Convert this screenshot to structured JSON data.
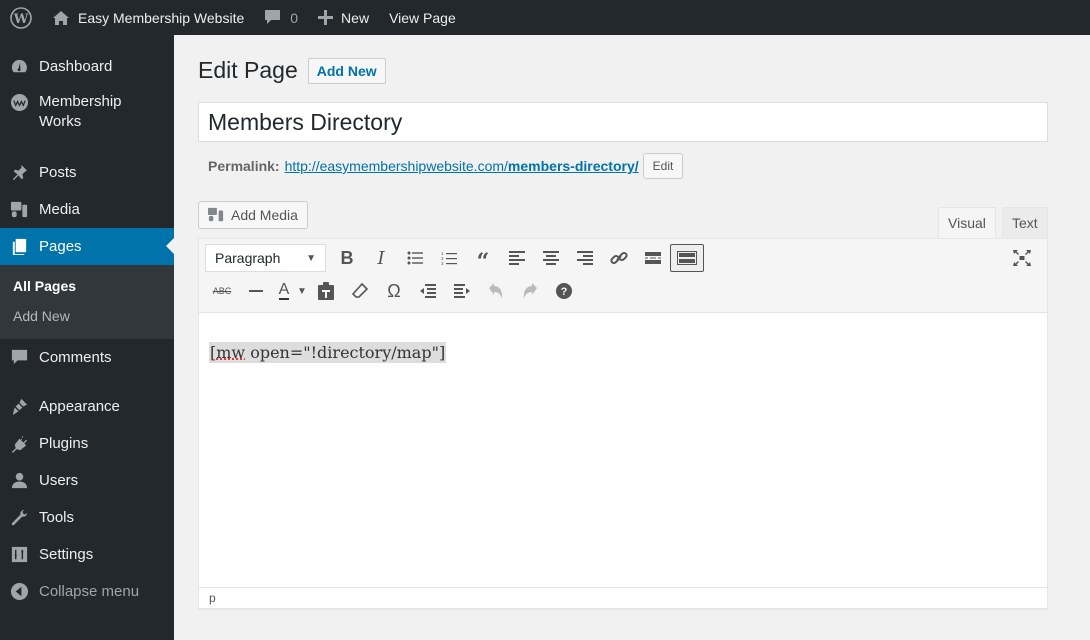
{
  "adminbar": {
    "site_name": "Easy Membership Website",
    "comments_count": "0",
    "new_label": "New",
    "view_page_label": "View Page"
  },
  "sidebar": {
    "items": [
      {
        "label": "Dashboard",
        "icon": "dashboard-icon"
      },
      {
        "label": "Membership Works",
        "icon": "membershipworks-icon"
      },
      {
        "label": "Posts",
        "icon": "pin-icon"
      },
      {
        "label": "Media",
        "icon": "media-icon"
      },
      {
        "label": "Pages",
        "icon": "pages-icon",
        "active": true
      },
      {
        "label": "Comments",
        "icon": "comment-icon"
      },
      {
        "label": "Appearance",
        "icon": "brush-icon"
      },
      {
        "label": "Plugins",
        "icon": "plug-icon"
      },
      {
        "label": "Users",
        "icon": "user-icon"
      },
      {
        "label": "Tools",
        "icon": "wrench-icon"
      },
      {
        "label": "Settings",
        "icon": "sliders-icon"
      }
    ],
    "submenu": [
      {
        "label": "All Pages",
        "current": true
      },
      {
        "label": "Add New"
      }
    ],
    "collapse_label": "Collapse menu"
  },
  "main": {
    "heading": "Edit Page",
    "add_new_label": "Add New",
    "title_value": "Members Directory",
    "permalink_label": "Permalink:",
    "permalink_base": "http://easymembershipwebsite.com/",
    "permalink_slug": "members-directory/",
    "edit_label": "Edit",
    "add_media_label": "Add Media",
    "tabs": {
      "visual": "Visual",
      "text": "Text"
    },
    "format_select": "Paragraph",
    "content": {
      "prefix": "[",
      "misspelled": "mw",
      "rest": " open=\"!directory/map\"]"
    },
    "status_path": "p"
  }
}
